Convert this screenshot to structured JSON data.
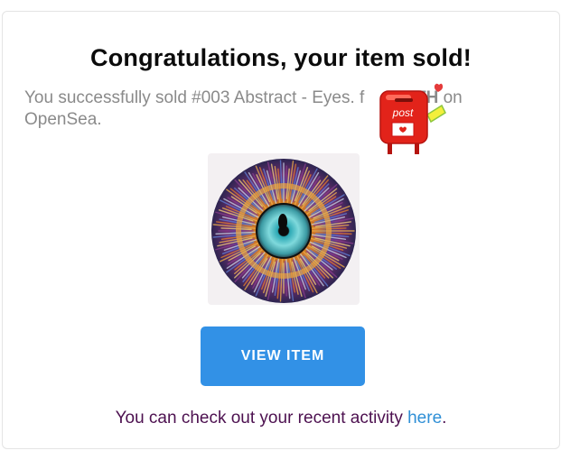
{
  "email": {
    "title": "Congratulations, your item sold!",
    "message_prefix": "You successfully sold #003 Abstract - Eyes. f",
    "message_eth": "ETH",
    "message_suffix": " on OpenSea.",
    "view_button_label": "VIEW ITEM",
    "footer_prefix": "You can check out your recent activity ",
    "footer_link": "here",
    "footer_suffix": "."
  },
  "sticker": {
    "text": "post"
  },
  "colors": {
    "button": "#3291e6",
    "link": "#2f8fd6",
    "footer_text": "#4d1150",
    "message_text": "#8a8a8a"
  }
}
